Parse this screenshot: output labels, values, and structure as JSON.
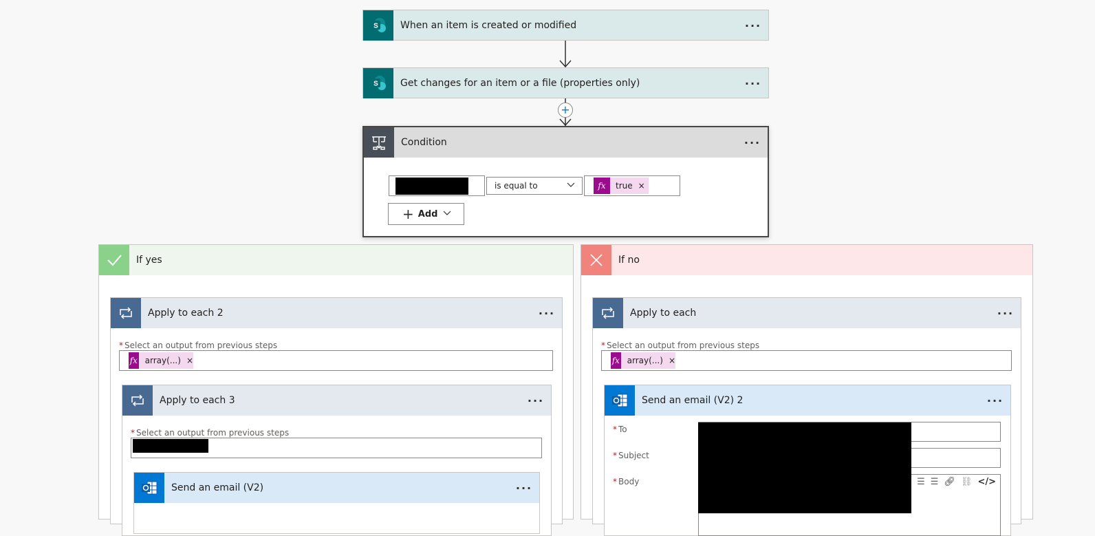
{
  "steps": {
    "trigger": {
      "title": "When an item is created or modified",
      "more": "···"
    },
    "get_changes": {
      "title": "Get changes for an item or a file (properties only)",
      "more": "···"
    },
    "condition": {
      "title": "Condition",
      "more": "···",
      "operator": "is equal to",
      "value_token": "true",
      "add_label": "Add"
    }
  },
  "branches": {
    "yes": {
      "label": "If yes",
      "apply2": {
        "title": "Apply to each 2",
        "more": "···",
        "select_label": "Select an output from previous steps",
        "token": "array(...)"
      },
      "apply3": {
        "title": "Apply to each 3",
        "more": "···",
        "select_label": "Select an output from previous steps"
      },
      "send_email": {
        "title": "Send an email (V2)",
        "more": "···"
      }
    },
    "no": {
      "label": "If no",
      "apply": {
        "title": "Apply to each",
        "more": "···",
        "select_label": "Select an output from previous steps",
        "token": "array(...)"
      },
      "send_email2": {
        "title": "Send an email (V2) 2",
        "more": "···",
        "to_label": "To",
        "subject_label": "Subject",
        "body_label": "Body"
      }
    }
  },
  "colors": {
    "sharepoint_header": "#dae9e9",
    "condition_header": "#dcdcdc",
    "yes_header": "#eef6ee",
    "no_header": "#fde7e9",
    "loop_header": "#e4e9f0",
    "outlook_header": "#d9e9f7",
    "fx": "#9b0b8d"
  }
}
